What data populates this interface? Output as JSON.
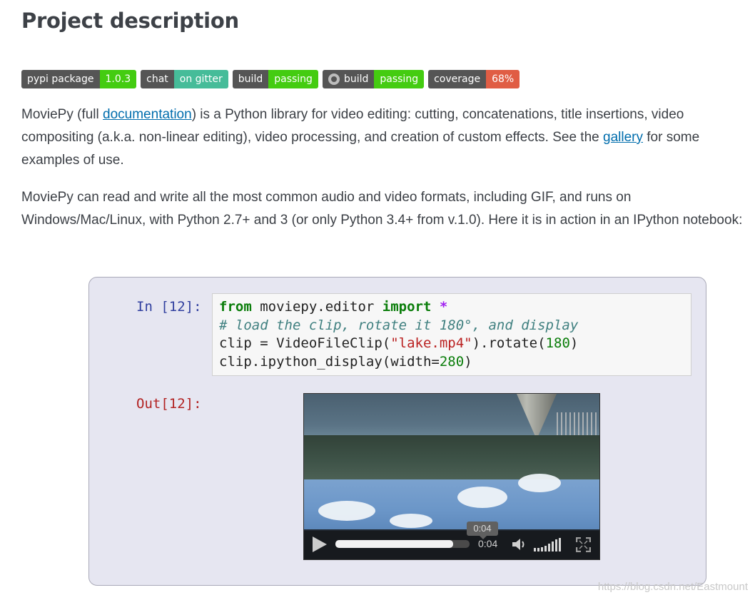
{
  "page": {
    "title": "Project description"
  },
  "badges": [
    {
      "left": "pypi package",
      "right": "1.0.3",
      "right_color": "#4c1"
    },
    {
      "left": "chat",
      "right": "on gitter",
      "right_color": "#46bc99"
    },
    {
      "left": "build",
      "right": "passing",
      "right_color": "#4c1"
    },
    {
      "left": "build",
      "right": "passing",
      "right_color": "#4c1",
      "icon": "github-icon"
    },
    {
      "left": "coverage",
      "right": "68%",
      "right_color": "#e05d44"
    }
  ],
  "para1": {
    "t1": "MoviePy (full ",
    "link1": "documentation",
    "t2": ") is a Python library for video editing: cutting, concatenations, title insertions, video compositing (a.k.a. non-linear editing), video processing, and creation of custom effects. See the ",
    "link2": "gallery",
    "t3": " for some examples of use."
  },
  "para2": {
    "text": "MoviePy can read and write all the most common audio and video formats, including GIF, and runs on Windows/Mac/Linux, with Python 2.7+ and 3 (or only Python 3.4+ from v.1.0). Here it is in action in an IPython notebook:"
  },
  "notebook": {
    "in_prompt": "In [12]:",
    "out_prompt": "Out[12]:",
    "code": {
      "l1_kw1": "from",
      "l1_mod": " moviepy.editor ",
      "l1_kw2": "import",
      "l1_star": " *",
      "l2_comment": "# load the clip, rotate it 180°, and display",
      "l3_a": "clip = VideoFileClip(",
      "l3_str": "\"lake.mp4\"",
      "l3_b": ").rotate(",
      "l3_num": "180",
      "l3_c": ")",
      "l4_a": "clip.ipython_display(width=",
      "l4_num": "280",
      "l4_b": ")"
    },
    "video": {
      "tooltip_time": "0:04",
      "current_time": "0:04",
      "progress": 0.88
    }
  },
  "watermark": "https://blog.csdn.net/Eastmount"
}
